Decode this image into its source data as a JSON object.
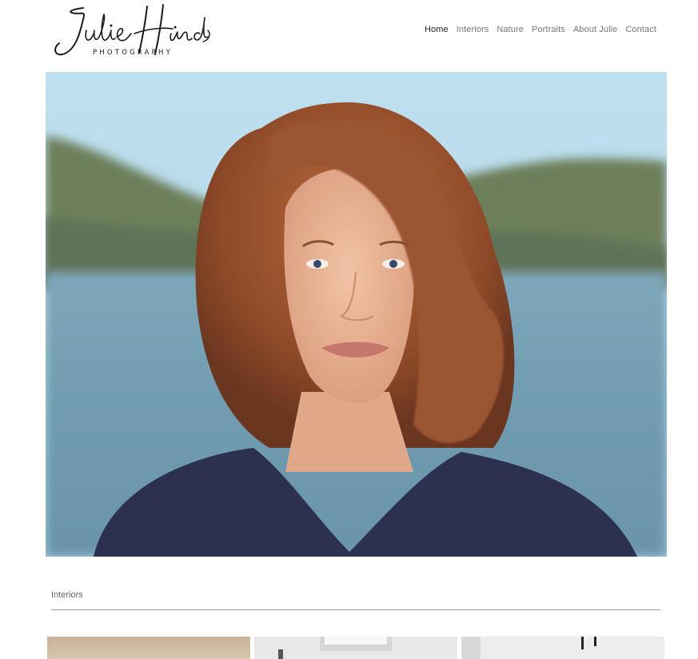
{
  "brand": {
    "name": "Julie Hinds",
    "tagline": "PHOTOGRAPHY"
  },
  "nav": {
    "items": [
      {
        "label": "Home",
        "active": true
      },
      {
        "label": "Interiors",
        "active": false
      },
      {
        "label": "Nature",
        "active": false
      },
      {
        "label": "Portraits",
        "active": false
      },
      {
        "label": "About Julie",
        "active": false
      },
      {
        "label": "Contact",
        "active": false
      }
    ]
  },
  "sections": {
    "interiors": {
      "title": "Interiors",
      "thumbnail_count": 3
    }
  },
  "colors": {
    "nav_text": "#777777",
    "nav_active": "#222222",
    "rule": "#9a9a9a"
  }
}
